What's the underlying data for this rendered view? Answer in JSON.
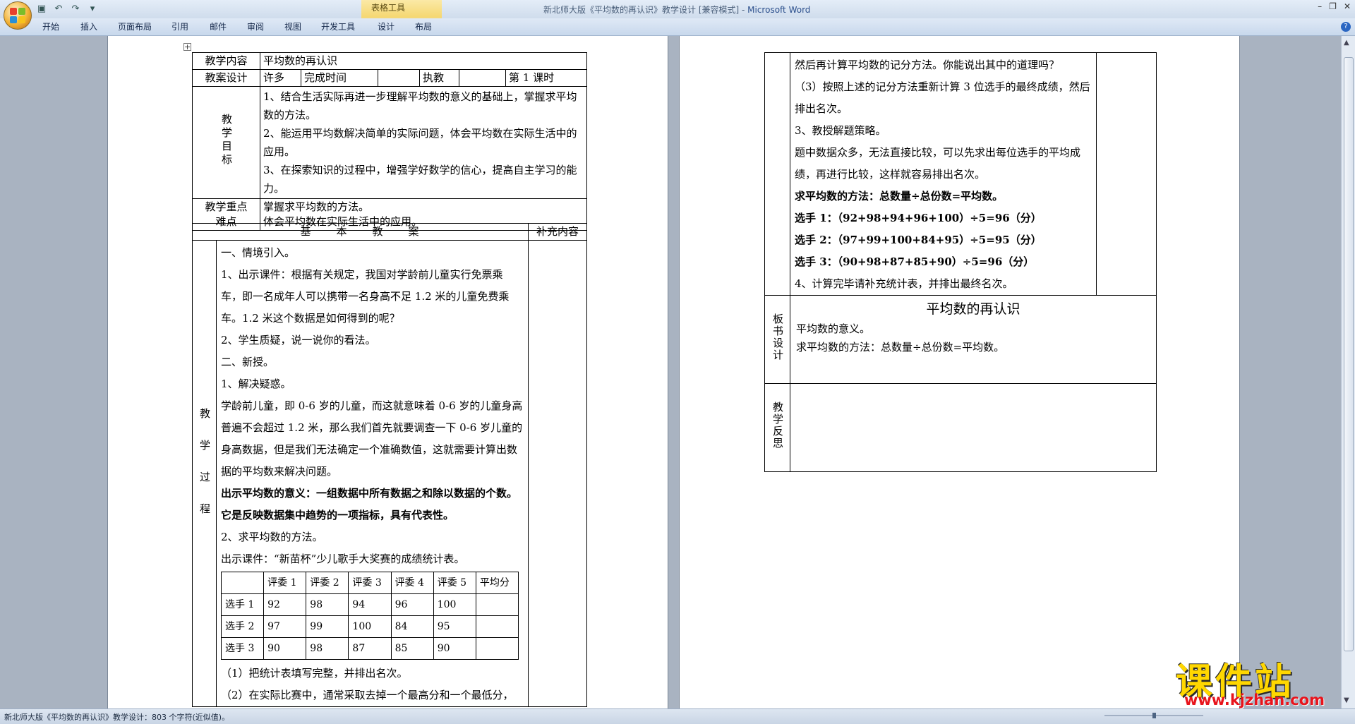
{
  "window": {
    "title_doc": "新北师大版《平均数的再认识》教学设计 [兼容模式] - ",
    "title_app": "Microsoft Word",
    "context_tab_group": "表格工具",
    "controls": [
      "–",
      "❐",
      "✕"
    ]
  },
  "ribbon": {
    "tabs": [
      "开始",
      "插入",
      "页面布局",
      "引用",
      "邮件",
      "审阅",
      "视图",
      "开发工具",
      "设计",
      "布局"
    ]
  },
  "qat_icons": [
    "save-icon",
    "undo-icon",
    "redo-icon",
    "customize-icon"
  ],
  "table1": {
    "content_label": "教学内容",
    "content_value": "平均数的再认识",
    "design_label": "教案设计",
    "designer": "许多",
    "complete_time_label": "完成时间",
    "teacher_label": "执教",
    "lesson": "第 1 课时",
    "goals_label": "教学目标",
    "goals": [
      "1、结合生活实际再进一步理解平均数的意义的基础上，掌握求平均数的方法。",
      "2、能运用平均数解决简单的实际问题，体会平均数在实际生活中的应用。",
      "3、在探索知识的过程中，增强学好数学的信心，提高自主学习的能力。"
    ],
    "key_label_1": "教学重点",
    "key_label_2": "难点",
    "key_1": "掌握求平均数的方法。",
    "key_2": "体会平均数在实际生活中的应用。",
    "basic_header": "基　　本　　教　　案",
    "supplement_header": "补充内容",
    "process_label": "教学过程"
  },
  "process": {
    "p1": "一、情境引入。",
    "p2": "1、出示课件：根据有关规定，我国对学龄前儿童实行免票乘车，即一名成年人可以携带一名身高不足 1.2 米的儿童免费乘车。1.2 米这个数据是如何得到的呢？",
    "p3": "2、学生质疑，说一说你的看法。",
    "p4": "二、新授。",
    "p5": "1、解决疑惑。",
    "p6": "学龄前儿童，即 0-6 岁的儿童，而这就意味着 0-6 岁的儿童身高普遍不会超过 1.2 米，那么我们首先就要调查一下 0-6 岁儿童的身高数据，但是我们无法确定一个准确数值，这就需要计算出数据的平均数来解决问题。",
    "p7": "出示平均数的意义：一组数据中所有数据之和除以数据的个数。它是反映数据集中趋势的一项指标，具有代表性。",
    "p8": "2、求平均数的方法。",
    "p9": "出示课件：“新苗杯”少儿歌手大奖赛的成绩统计表。",
    "score_headers": [
      "",
      "评委 1",
      "评委 2",
      "评委 3",
      "评委 4",
      "评委 5",
      "平均分"
    ],
    "score_rows": [
      [
        "选手 1",
        "92",
        "98",
        "94",
        "96",
        "100",
        ""
      ],
      [
        "选手 2",
        "97",
        "99",
        "100",
        "84",
        "95",
        ""
      ],
      [
        "选手 3",
        "90",
        "98",
        "87",
        "85",
        "90",
        ""
      ]
    ],
    "p10": "（1）把统计表填写完整，并排出名次。",
    "p11": "（2）在实际比赛中，通常采取去掉一个最高分和一个最低分，"
  },
  "page2": {
    "l1": "然后再计算平均数的记分方法。你能说出其中的道理吗？",
    "l2": "（3）按照上述的记分方法重新计算 3 位选手的最终成绩，然后排出名次。",
    "l3": "3、教授解题策略。",
    "l4": "题中数据众多，无法直接比较，可以先求出每位选手的平均成绩，再进行比较，这样就容易排出名次。",
    "l5": "求平均数的方法：总数量÷总份数=平均数。",
    "l6": "选手 1：（92+98+94+96+100）÷5=96（分）",
    "l7": "选手 2：（97+99+100+84+95）÷5=95（分）",
    "l8": "选手 3：（90+98+87+85+90）÷5=96（分）",
    "l9": "4、计算完毕请补充统计表，并排出最终名次。",
    "board_label": "板书设计",
    "board_title": "平均数的再认识",
    "board_1": "平均数的意义。",
    "board_2": "求平均数的方法：总数量÷总份数=平均数。",
    "reflect_label": "教学反思"
  },
  "status": {
    "text": "新北师大版《平均数的再认识》教学设计：803 个字符(近似值)。"
  },
  "watermark": {
    "text": "课件站",
    "url": "www.kjzhan.com"
  },
  "colors": {
    "ribbon": "#d3e1f1",
    "context_tab": "#f5d873",
    "watermark_text": "#ffd700",
    "watermark_url": "#e8141c"
  }
}
